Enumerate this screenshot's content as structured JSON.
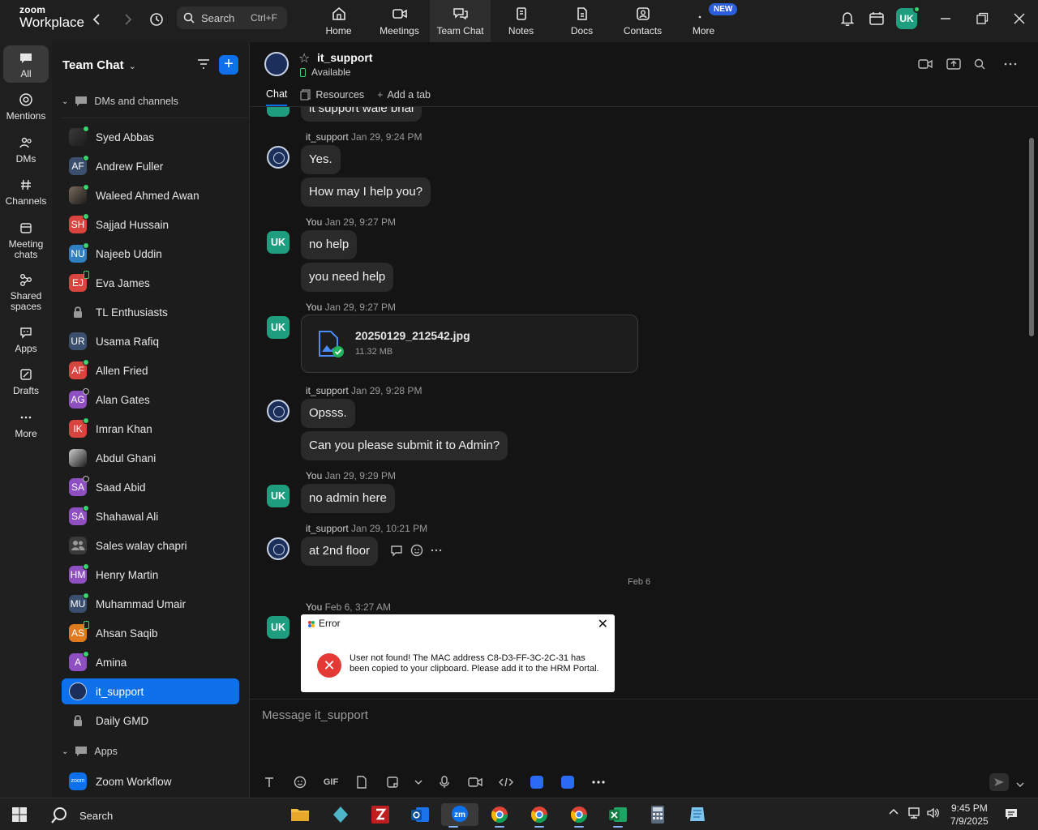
{
  "topbar": {
    "logo_line1": "zoom",
    "logo_line2": "Workplace",
    "search_placeholder": "Search",
    "search_shortcut": "Ctrl+F",
    "tabs": [
      {
        "label": "Home",
        "icon": "home-icon"
      },
      {
        "label": "Meetings",
        "icon": "video-icon"
      },
      {
        "label": "Team Chat",
        "icon": "chat-icon",
        "active": true
      },
      {
        "label": "Notes",
        "icon": "notes-icon"
      },
      {
        "label": "Docs",
        "icon": "docs-icon"
      },
      {
        "label": "Contacts",
        "icon": "contacts-icon"
      },
      {
        "label": "More",
        "icon": "more-icon",
        "badge": "NEW"
      }
    ],
    "avatar_initials": "UK"
  },
  "rail": {
    "items": [
      {
        "label": "All",
        "active": true
      },
      {
        "label": "Mentions"
      },
      {
        "label": "DMs"
      },
      {
        "label": "Channels"
      },
      {
        "label": "Meeting chats"
      },
      {
        "label": "Shared spaces"
      },
      {
        "label": "Apps"
      },
      {
        "label": "Drafts"
      },
      {
        "label": "More"
      }
    ]
  },
  "sidebar": {
    "title": "Team Chat",
    "section_dms": "DMs and channels",
    "section_apps": "Apps",
    "contacts": [
      {
        "name": "Syed Abbas",
        "initials": "",
        "color": "#3a3a3a",
        "presence": "online",
        "photo": true
      },
      {
        "name": "Andrew Fuller",
        "initials": "AF",
        "color": "#3a4f6e",
        "presence": "online"
      },
      {
        "name": "Waleed Ahmed Awan",
        "initials": "",
        "color": "#7a6a5a",
        "presence": "online",
        "photo": true
      },
      {
        "name": "Sajjad Hussain",
        "initials": "SH",
        "color": "#d9443f",
        "presence": "online"
      },
      {
        "name": "Najeeb Uddin",
        "initials": "NU",
        "color": "#2f7fc1",
        "presence": "online"
      },
      {
        "name": "Eva James",
        "initials": "EJ",
        "color": "#d9443f",
        "presence": "mobile"
      },
      {
        "name": "TL Enthusiasts",
        "initials": "",
        "color": "#3a3a3a",
        "presence": "none",
        "lock": true
      },
      {
        "name": "Usama Rafiq",
        "initials": "UR",
        "color": "#3a4f6e",
        "presence": "none"
      },
      {
        "name": "Allen Fried",
        "initials": "AF",
        "color": "#d9443f",
        "presence": "online"
      },
      {
        "name": "Alan Gates",
        "initials": "AG",
        "color": "#8e4fc1",
        "presence": "idle"
      },
      {
        "name": "Imran Khan",
        "initials": "IK",
        "color": "#d9443f",
        "presence": "online"
      },
      {
        "name": "Abdul Ghani",
        "initials": "",
        "color": "#cfcfcf",
        "presence": "none",
        "photo": true
      },
      {
        "name": "Saad Abid",
        "initials": "SA",
        "color": "#8e4fc1",
        "presence": "idle"
      },
      {
        "name": "Shahawal Ali",
        "initials": "SA",
        "color": "#8e4fc1",
        "presence": "online"
      },
      {
        "name": "Sales walay chapri",
        "initials": "",
        "color": "#3a3a3a",
        "presence": "none",
        "group": true
      },
      {
        "name": "Henry Martin",
        "initials": "HM",
        "color": "#8e4fc1",
        "presence": "online"
      },
      {
        "name": "Muhammad Umair",
        "initials": "MU",
        "color": "#3a4f6e",
        "presence": "online"
      },
      {
        "name": "Ahsan Saqib",
        "initials": "AS",
        "color": "#e07a1f",
        "presence": "mobile"
      },
      {
        "name": "Amina",
        "initials": "A",
        "color": "#8e4fc1",
        "presence": "online"
      },
      {
        "name": "it_support",
        "initials": "",
        "color": "#1b2f5a",
        "presence": "none",
        "active": true,
        "itlogo": true
      },
      {
        "name": "Daily GMD",
        "initials": "",
        "color": "#3a3a3a",
        "presence": "none",
        "lock": true
      }
    ],
    "apps": [
      {
        "name": "Zoom Workflow",
        "initials": "zoom",
        "color": "#0e71eb"
      }
    ]
  },
  "channel": {
    "name": "it_support",
    "status": "Available",
    "tabs": [
      "Chat",
      "Resources",
      "Add a tab"
    ]
  },
  "messages": {
    "top_partial": "it support wale bhai",
    "g1_sender": "it_support",
    "g1_time": "Jan 29, 9:24 PM",
    "g1_m1": "Yes.",
    "g1_m2": "How may I help you?",
    "g2_sender": "You",
    "g2_time": "Jan 29, 9:27 PM",
    "g2_m1": "no help",
    "g2_m2": "you need help",
    "g3_sender": "You",
    "g3_time": "Jan 29, 9:27 PM",
    "file_name": "20250129_212542.jpg",
    "file_size": "11.32 MB",
    "g4_sender": "it_support",
    "g4_time": "Jan 29, 9:28 PM",
    "g4_m1": "Opsss.",
    "g4_m2": "Can you please submit it to Admin?",
    "g5_sender": "You",
    "g5_time": "Jan 29, 9:29 PM",
    "g5_m1": "no admin here",
    "g6_sender": "it_support",
    "g6_time": "Jan 29, 10:21 PM",
    "g6_m1": "at 2nd floor",
    "date_sep": "Feb 6",
    "g7_sender": "You",
    "g7_time": "Feb 6, 3:27 AM",
    "avatar_initials": "UK"
  },
  "error_dialog": {
    "title": "Error",
    "text": "User not found! The MAC address C8-D3-FF-3C-2C-31 has been copied to your clipboard. Please add it to the HRM Portal."
  },
  "compose": {
    "placeholder": "Message it_support",
    "gif_label": "GIF"
  },
  "taskbar": {
    "search_label": "Search",
    "time": "9:45 PM",
    "date": "7/9/2025"
  },
  "colors": {
    "accent": "#0e71eb",
    "online": "#3bd16f",
    "uk_avatar": "#1f9e7f",
    "error_red": "#e53935"
  }
}
